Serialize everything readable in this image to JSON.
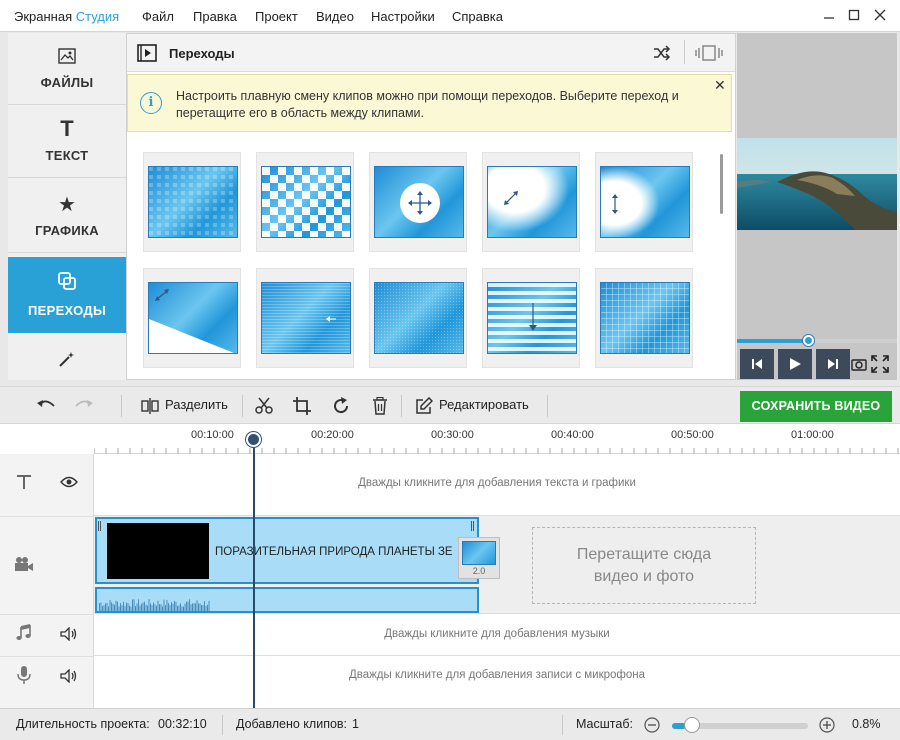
{
  "app": {
    "title_main": "Экранная ",
    "title_accent": "Студия",
    "menu": [
      "Файл",
      "Правка",
      "Проект",
      "Видео",
      "Настройки",
      "Справка"
    ],
    "accent_color": "#2aa1d6"
  },
  "sidebar": {
    "items": [
      {
        "label": "ФАЙЛЫ",
        "icon": "image-icon"
      },
      {
        "label": "ТЕКСТ",
        "icon": "text-icon"
      },
      {
        "label": "ГРАФИКА",
        "icon": "star-icon"
      },
      {
        "label": "ПЕРЕХОДЫ",
        "icon": "transitions-icon",
        "active": true
      },
      {
        "label": "",
        "icon": "magic-wand-icon"
      }
    ]
  },
  "panel": {
    "title": "Переходы",
    "info": "Настроить плавную смену клипов можно при помощи переходов. Выберите переход и перетащите его в область между клипами.",
    "info_close": "✕",
    "transitions_count": 10
  },
  "preview": {
    "progress": 0.45
  },
  "toolbar": {
    "split": "Разделить",
    "edit": "Редактировать",
    "save": "СОХРАНИТЬ ВИДЕО",
    "save_color": "#2aa43a"
  },
  "timeline": {
    "ticks": [
      "00:10:00",
      "00:20:00",
      "00:30:00",
      "00:40:00",
      "00:50:00",
      "01:00:00"
    ],
    "text_hint": "Дважды кликните для добавления текста и графики",
    "clip_title": "ПОРАЗИТЕЛЬНАЯ ПРИРОДА ПЛАНЕТЫ ЗЕ",
    "transition_duration": "2.0",
    "drop_line1": "Перетащите сюда",
    "drop_line2": "видео и фото",
    "music_hint": "Дважды кликните для добавления музыки",
    "mic_hint": "Дважды кликните для добавления записи с микрофона"
  },
  "status": {
    "duration_label": "Длительность проекта:",
    "duration_value": "00:32:10",
    "clips_label": "Добавлено клипов:",
    "clips_value": "1",
    "scale_label": "Масштаб:",
    "scale_value": "0.8%",
    "scale_level": 0.1
  }
}
